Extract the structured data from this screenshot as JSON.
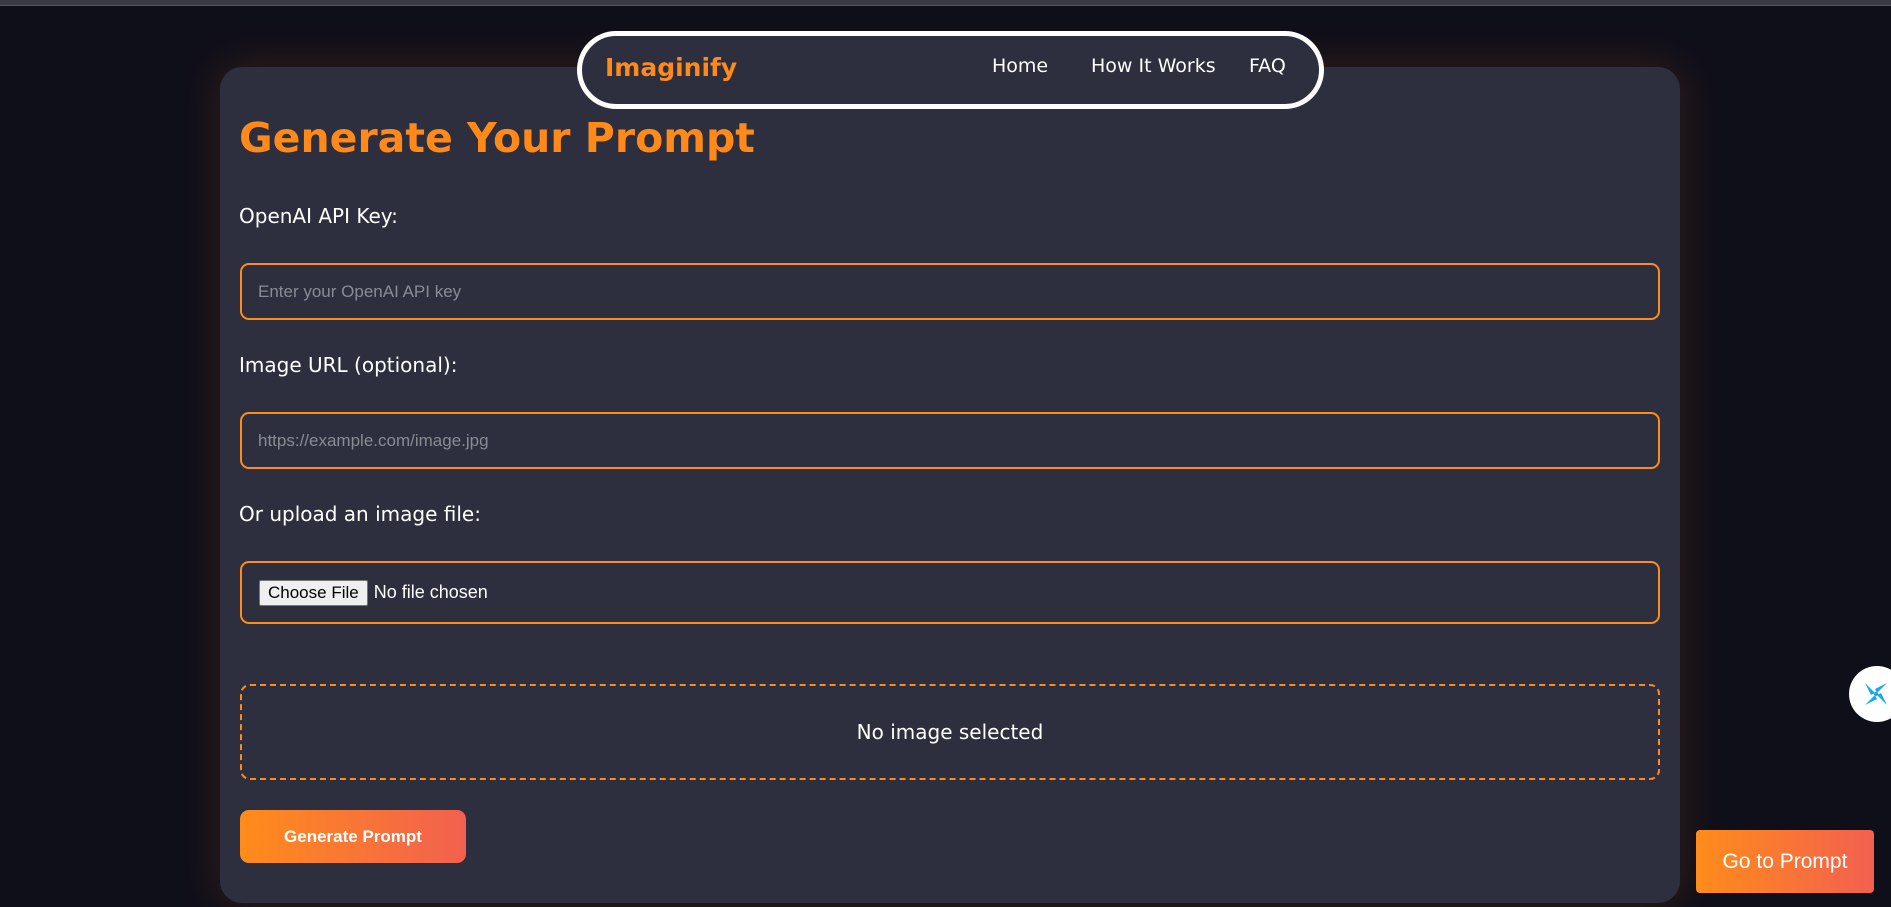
{
  "navbar": {
    "brand": "Imaginify",
    "links": [
      "Home",
      "How It Works",
      "FAQ"
    ]
  },
  "form": {
    "title": "Generate Your Prompt",
    "api_key_label": "OpenAI API Key:",
    "api_key_placeholder": "Enter your OpenAI API key",
    "api_key_value": "",
    "image_url_label": "Image URL (optional):",
    "image_url_placeholder": "https://example.com/image.jpg",
    "image_url_value": "",
    "upload_label": "Or upload an image file:",
    "choose_file_label": "Choose File",
    "no_file_text": "No file chosen",
    "preview_text": "No image selected",
    "generate_label": "Generate Prompt"
  },
  "floating": {
    "goto_label": "Go to Prompt",
    "widget_icon": "pinwheel-icon"
  },
  "colors": {
    "accent": "#ff8a1a",
    "card_bg": "#2d2f3e",
    "page_bg": "#0f0f1a",
    "gradient_end": "#f26050"
  }
}
